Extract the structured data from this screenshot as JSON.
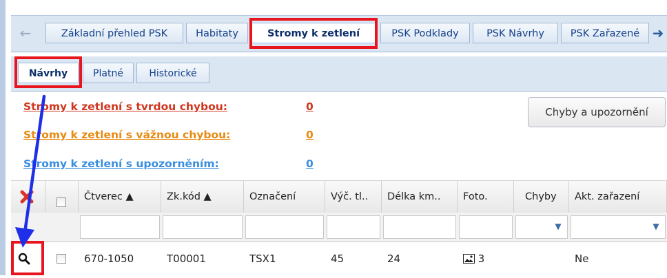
{
  "colors": {
    "highlight": "#e8141e",
    "arrow": "#1f2ee8",
    "error_link": "#d0361e",
    "serious_link": "#e88a12",
    "warning_link": "#3a8ee0",
    "tab_text": "#15428b"
  },
  "top_tabs": {
    "items": [
      {
        "label": "Základní přehled PSK"
      },
      {
        "label": "Habitaty"
      },
      {
        "label": "Stromy k zetlení",
        "active": true
      },
      {
        "label": "PSK Podklady"
      },
      {
        "label": "PSK Návrhy"
      },
      {
        "label": "PSK Zařazené"
      }
    ],
    "scroll_left_icon": "arrow-left-icon",
    "scroll_right_icon": "arrow-right-icon"
  },
  "sub_tabs": {
    "items": [
      {
        "label": "Návrhy",
        "active": true
      },
      {
        "label": "Platné"
      },
      {
        "label": "Historické"
      }
    ]
  },
  "summary": {
    "hard_errors": {
      "label": "Stromy k zetlení s tvrdou chybou:",
      "count": "0"
    },
    "serious_errors": {
      "label": "Stromy k zetlení s vážnou chybou:",
      "count": "0"
    },
    "warnings": {
      "label": "Stromy k zetlení s upozorněním:",
      "count": "0"
    }
  },
  "errors_button": {
    "label": "Chyby a upozornění"
  },
  "grid": {
    "clear_filter_icon": "red-x-icon",
    "columns": [
      {
        "label": "Čtverec ▲"
      },
      {
        "label": "Zk.kód ▲"
      },
      {
        "label": "Označení"
      },
      {
        "label": "Výč. tl.."
      },
      {
        "label": "Délka km.."
      },
      {
        "label": "Foto."
      },
      {
        "label": "Chyby"
      },
      {
        "label": "Akt. zařazení"
      }
    ],
    "rows": [
      {
        "ctverec": "670-1050",
        "zk_kod": "T00001",
        "oznaceni": "TSX1",
        "vyc_tl": "45",
        "delka": "24",
        "foto": "3",
        "chyby": "",
        "akt_zarazeni": "Ne",
        "detail_icon": "magnifier-icon",
        "photo_icon": "image-icon"
      }
    ]
  }
}
